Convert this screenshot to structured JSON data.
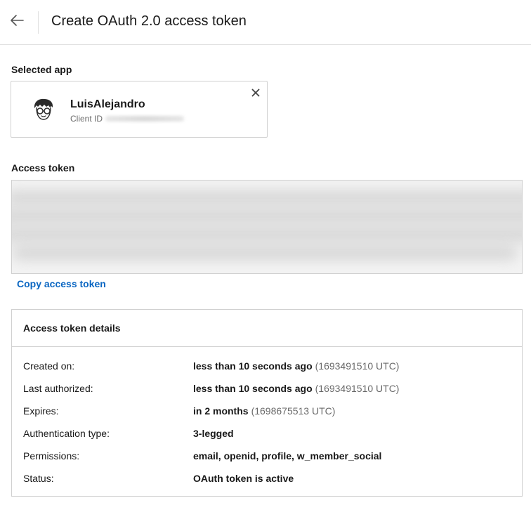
{
  "header": {
    "title": "Create OAuth 2.0 access token",
    "back_icon": "arrow-left-icon"
  },
  "selected_app": {
    "label": "Selected app",
    "name": "LuisAlejandro",
    "client_id_label": "Client ID",
    "avatar_icon": "avatar-glasses-icon",
    "close_icon": "close-icon"
  },
  "access_token": {
    "label": "Access token",
    "copy_label": "Copy access token"
  },
  "details": {
    "title": "Access token details",
    "rows": [
      {
        "label": "Created on:",
        "value": "less than 10 seconds ago",
        "sub": "(1693491510 UTC)"
      },
      {
        "label": "Last authorized:",
        "value": "less than 10 seconds ago",
        "sub": "(1693491510 UTC)"
      },
      {
        "label": "Expires:",
        "value": "in 2 months",
        "sub": "(1698675513 UTC)"
      },
      {
        "label": "Authentication type:",
        "value": "3-legged",
        "sub": ""
      },
      {
        "label": "Permissions:",
        "value": "email, openid, profile, w_member_social",
        "sub": ""
      },
      {
        "label": "Status:",
        "value": "OAuth token is active",
        "sub": ""
      }
    ]
  },
  "colors": {
    "link": "#0a66c2",
    "border": "#d0d0d0",
    "token_bg": "#f3f3f3"
  }
}
